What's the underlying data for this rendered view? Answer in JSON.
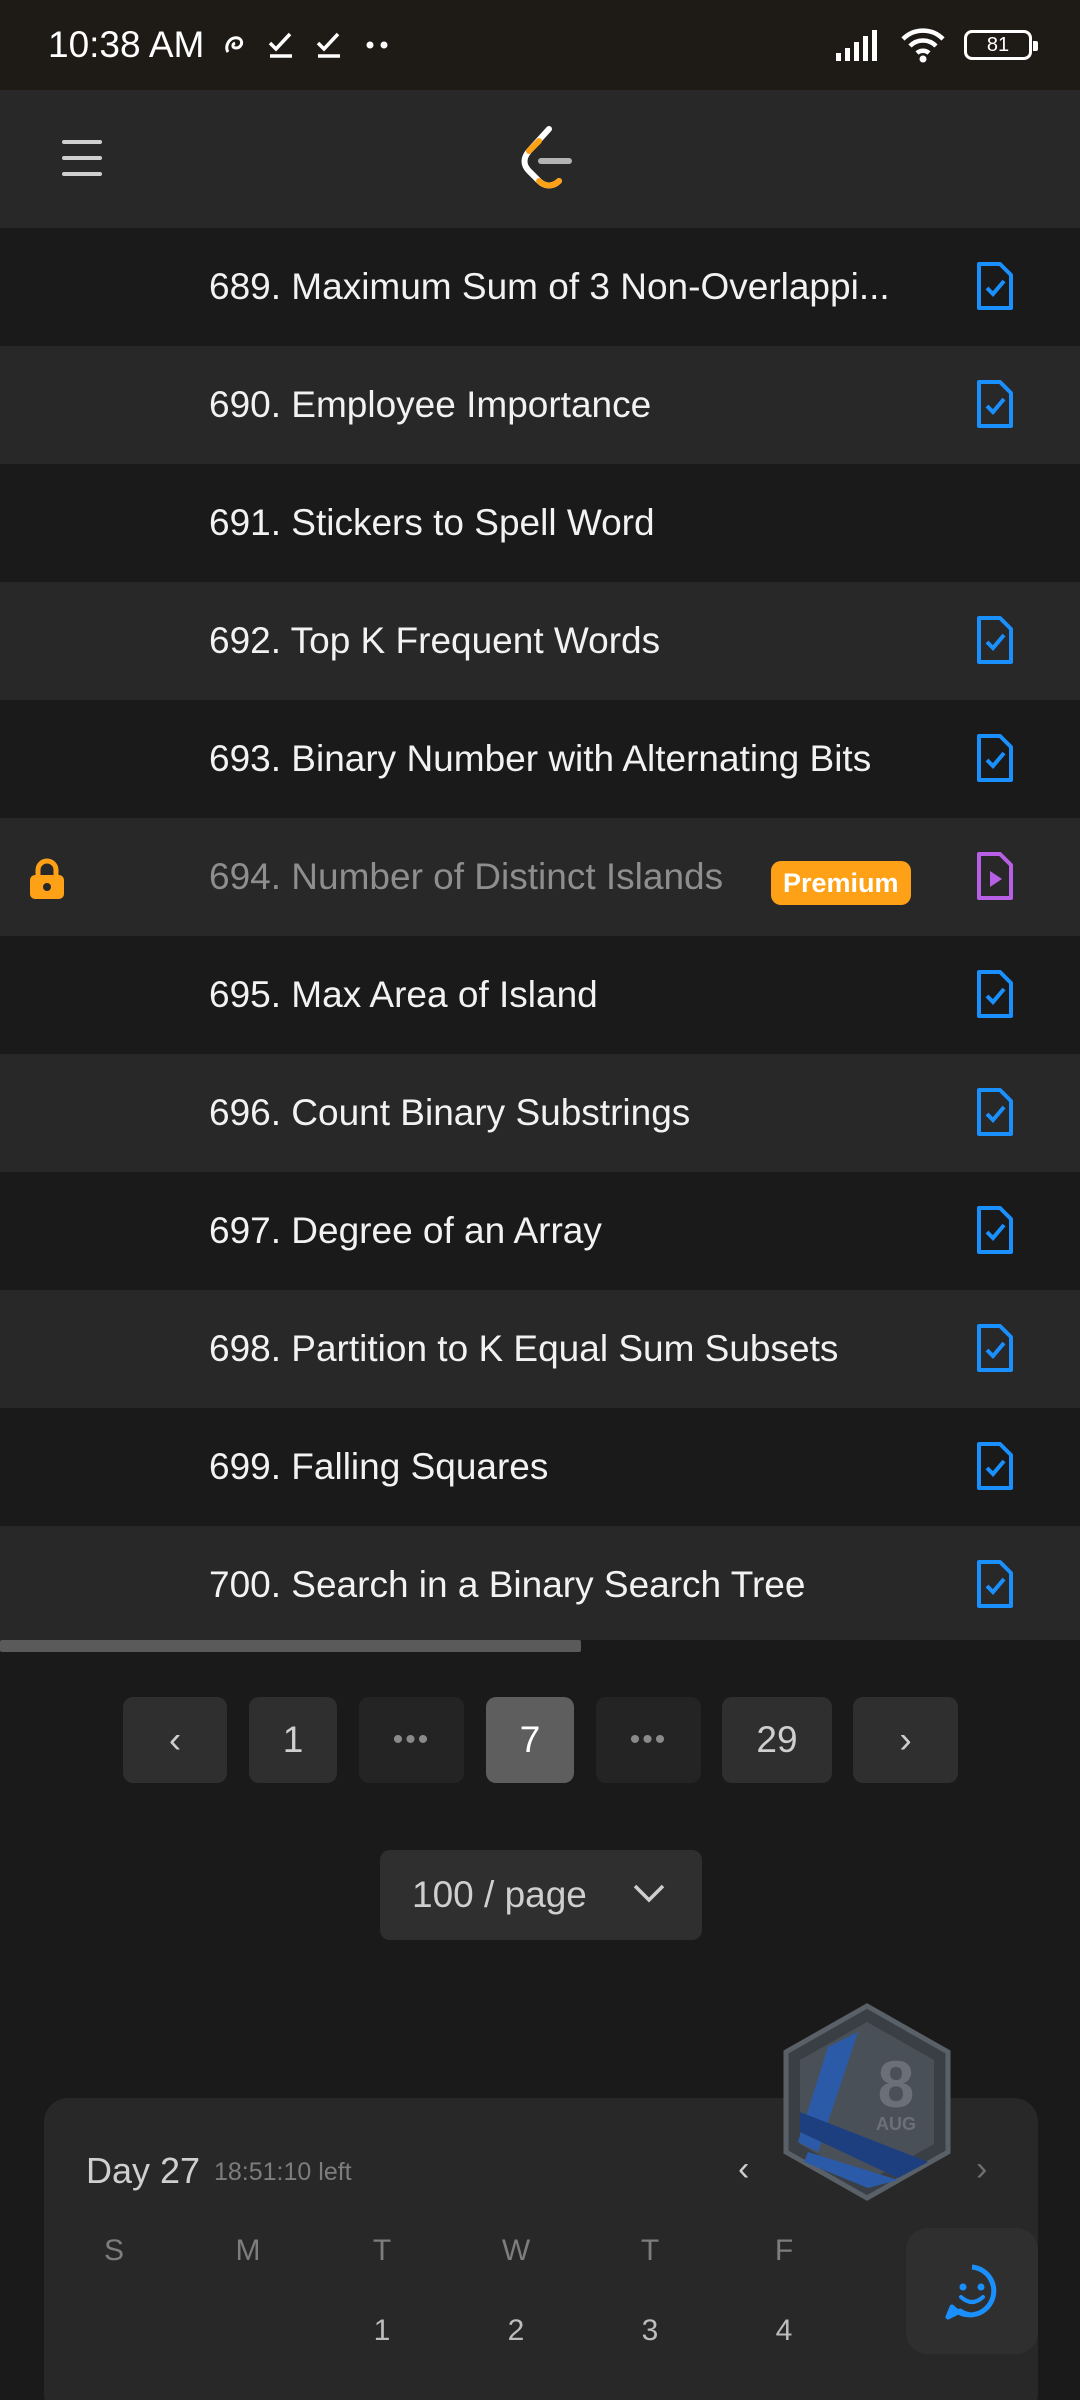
{
  "status_bar": {
    "time": "10:38 AM",
    "battery": "81",
    "icons": [
      "notification-icon",
      "check-icon",
      "check-icon",
      "more-dots-icon",
      "signal-icon",
      "wifi-icon",
      "battery-icon"
    ]
  },
  "header": {
    "menu_icon": "hamburger-menu-icon",
    "logo": "leetcode-logo"
  },
  "problems": [
    {
      "title": "689. Maximum Sum of 3 Non-Overlappi...",
      "solution_icon": "solution-doc-check-icon",
      "locked": false
    },
    {
      "title": "690. Employee Importance",
      "solution_icon": "solution-doc-check-icon",
      "locked": false
    },
    {
      "title": "691. Stickers to Spell Word",
      "solution_icon": "",
      "locked": false
    },
    {
      "title": "692. Top K Frequent Words",
      "solution_icon": "solution-doc-check-icon",
      "locked": false
    },
    {
      "title": "693. Binary Number with Alternating Bits",
      "solution_icon": "solution-doc-check-icon",
      "locked": false
    },
    {
      "title": "694. Number of Distinct Islands",
      "solution_icon": "solution-video-icon",
      "locked": true,
      "badge": "Premium"
    },
    {
      "title": "695. Max Area of Island",
      "solution_icon": "solution-doc-check-icon",
      "locked": false
    },
    {
      "title": "696. Count Binary Substrings",
      "solution_icon": "solution-doc-check-icon",
      "locked": false
    },
    {
      "title": "697. Degree of an Array",
      "solution_icon": "solution-doc-check-icon",
      "locked": false
    },
    {
      "title": "698. Partition to K Equal Sum Subsets",
      "solution_icon": "solution-doc-check-icon",
      "locked": false
    },
    {
      "title": "699. Falling Squares",
      "solution_icon": "solution-doc-check-icon",
      "locked": false
    },
    {
      "title": "700. Search in a Binary Search Tree",
      "solution_icon": "solution-doc-check-icon",
      "locked": false
    }
  ],
  "pagination": {
    "prev": "‹",
    "first": "1",
    "ellipsis_left": "•••",
    "current": "7",
    "ellipsis_right": "•••",
    "last": "29",
    "next": "›",
    "page_size": "100 / page"
  },
  "calendar": {
    "title": "Day 27",
    "time_left": "18:51:10 left",
    "prev": "‹",
    "next": "›",
    "weekdays": [
      "S",
      "M",
      "T",
      "W",
      "T",
      "F",
      "S"
    ],
    "dates": [
      "1",
      "2",
      "3",
      "4"
    ],
    "badge_month": "AUG",
    "badge_day": "8"
  },
  "colors": {
    "accent_orange": "#ffa116",
    "solution_blue": "#1a90ff",
    "video_purple": "#b760e6"
  }
}
